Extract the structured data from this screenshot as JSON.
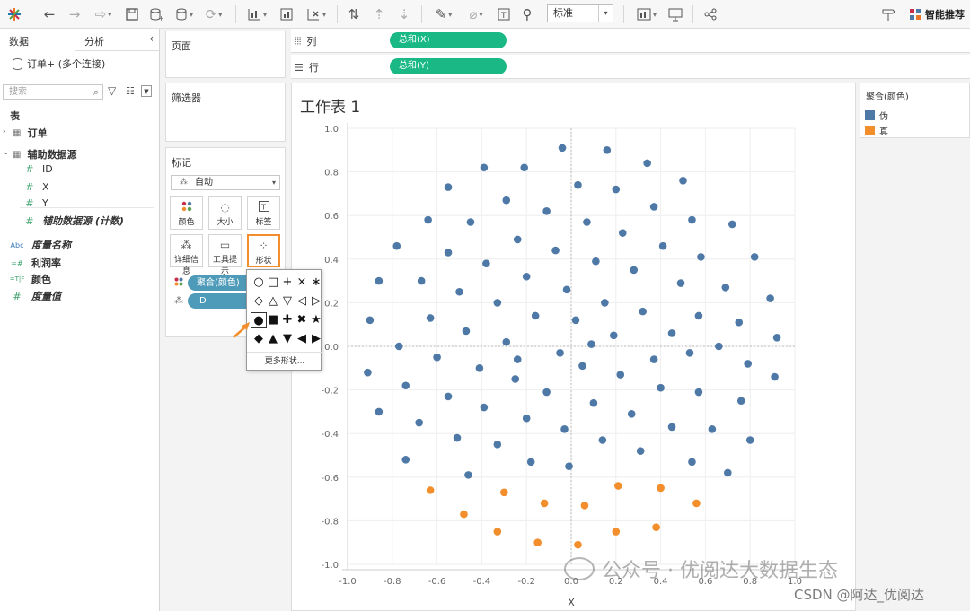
{
  "toolbar": {
    "standard_label": "标准",
    "smart_recommend": "智能推荐"
  },
  "left_pane": {
    "tab_data": "数据",
    "tab_analysis": "分析",
    "datasource": "订单+ (多个连接)",
    "search_placeholder": "搜索",
    "tables_header": "表",
    "table_orders": "订单",
    "table_aux": "辅助数据源",
    "fields": [
      "ID",
      "X",
      "Y",
      "辅助数据源 (计数)"
    ],
    "measure_names": "度量名称",
    "profit_rate": "利润率",
    "color": "颜色",
    "measure_values": "度量值",
    "icon_abc": "Abc",
    "icon_hash": "#",
    "icon_calc": "=#",
    "icon_bool": "=T|F"
  },
  "cards": {
    "pages": "页面",
    "filters": "筛选器",
    "marks": "标记",
    "mark_type": "自动",
    "buttons": {
      "color": "颜色",
      "size": "大小",
      "label": "标签",
      "detail": "详细信息",
      "tooltip": "工具提示",
      "shape": "形状"
    },
    "pill_color": "聚合(颜色)",
    "pill_id": "ID"
  },
  "shelves": {
    "columns_label": "列",
    "rows_label": "行",
    "columns_pill": "总和(X)",
    "rows_pill": "总和(Y)"
  },
  "worksheet": {
    "title": "工作表 1"
  },
  "legend": {
    "title": "聚合(颜色)",
    "items": [
      {
        "label": "伪",
        "color": "#4e79a7"
      },
      {
        "label": "真",
        "color": "#f28e2b"
      }
    ]
  },
  "shape_popup": {
    "shapes": [
      "○",
      "□",
      "+",
      "×",
      "∗",
      "◇",
      "△",
      "▽",
      "◁",
      "▷",
      "●",
      "■",
      "✚",
      "✖",
      "★",
      "◆",
      "▲",
      "▼",
      "◀",
      "▶"
    ],
    "selected_index": 10,
    "more": "更多形状..."
  },
  "watermark": {
    "line1": "公众号 · 优阅达大数据生态",
    "line2": "CSDN @阿达_优阅达"
  },
  "chart_data": {
    "type": "scatter",
    "title": "工作表 1",
    "xlabel": "X",
    "ylabel": "",
    "xlim": [
      -1.0,
      1.0
    ],
    "ylim": [
      -1.0,
      1.0
    ],
    "x_ticks": [
      "-1.0",
      "-0.8",
      "-0.6",
      "-0.4",
      "-0.2",
      "0.0",
      "0.2",
      "0.4",
      "0.6",
      "0.8",
      "1.0"
    ],
    "y_ticks": [
      "1.0",
      "0.8",
      "0.6",
      "0.4",
      "0.2",
      "0.0",
      "-0.2",
      "-0.4",
      "-0.6",
      "-0.8",
      "-1.0"
    ],
    "grid": true,
    "series": [
      {
        "name": "伪",
        "color": "#4e79a7",
        "points": [
          [
            -0.04,
            0.91
          ],
          [
            0.16,
            0.9
          ],
          [
            0.34,
            0.84
          ],
          [
            -0.39,
            0.82
          ],
          [
            -0.21,
            0.82
          ],
          [
            0.5,
            0.76
          ],
          [
            0.03,
            0.74
          ],
          [
            -0.55,
            0.73
          ],
          [
            0.2,
            0.72
          ],
          [
            -0.29,
            0.67
          ],
          [
            -0.11,
            0.62
          ],
          [
            0.37,
            0.64
          ],
          [
            0.07,
            0.57
          ],
          [
            -0.45,
            0.57
          ],
          [
            -0.64,
            0.58
          ],
          [
            0.54,
            0.58
          ],
          [
            0.72,
            0.56
          ],
          [
            0.23,
            0.52
          ],
          [
            -0.24,
            0.49
          ],
          [
            -0.78,
            0.46
          ],
          [
            -0.07,
            0.44
          ],
          [
            0.41,
            0.46
          ],
          [
            -0.55,
            0.43
          ],
          [
            0.58,
            0.41
          ],
          [
            0.82,
            0.41
          ],
          [
            -0.38,
            0.38
          ],
          [
            0.11,
            0.39
          ],
          [
            -0.2,
            0.32
          ],
          [
            0.28,
            0.35
          ],
          [
            -0.67,
            0.3
          ],
          [
            -0.86,
            0.3
          ],
          [
            0.69,
            0.27
          ],
          [
            -0.5,
            0.25
          ],
          [
            -0.02,
            0.26
          ],
          [
            0.49,
            0.29
          ],
          [
            -0.33,
            0.2
          ],
          [
            0.15,
            0.2
          ],
          [
            0.89,
            0.22
          ],
          [
            -0.16,
            0.14
          ],
          [
            0.32,
            0.16
          ],
          [
            0.57,
            0.14
          ],
          [
            -0.63,
            0.13
          ],
          [
            -0.9,
            0.12
          ],
          [
            0.02,
            0.12
          ],
          [
            0.75,
            0.11
          ],
          [
            -0.47,
            0.07
          ],
          [
            0.19,
            0.05
          ],
          [
            -0.29,
            0.02
          ],
          [
            0.45,
            0.06
          ],
          [
            0.92,
            0.04
          ],
          [
            -0.77,
            0.0
          ],
          [
            0.66,
            0.0
          ],
          [
            0.09,
            0.01
          ],
          [
            -0.05,
            -0.03
          ],
          [
            0.53,
            -0.03
          ],
          [
            -0.6,
            -0.05
          ],
          [
            -0.24,
            -0.06
          ],
          [
            0.37,
            -0.06
          ],
          [
            -0.41,
            -0.1
          ],
          [
            0.05,
            -0.09
          ],
          [
            0.79,
            -0.08
          ],
          [
            -0.91,
            -0.12
          ],
          [
            0.22,
            -0.13
          ],
          [
            -0.11,
            -0.21
          ],
          [
            0.91,
            -0.14
          ],
          [
            -0.74,
            -0.18
          ],
          [
            -0.25,
            -0.15
          ],
          [
            0.4,
            -0.19
          ],
          [
            -0.55,
            -0.23
          ],
          [
            0.57,
            -0.21
          ],
          [
            0.1,
            -0.26
          ],
          [
            -0.39,
            -0.28
          ],
          [
            0.76,
            -0.25
          ],
          [
            -0.86,
            -0.3
          ],
          [
            -0.2,
            -0.33
          ],
          [
            0.27,
            -0.31
          ],
          [
            -0.68,
            -0.35
          ],
          [
            0.45,
            -0.37
          ],
          [
            -0.03,
            -0.38
          ],
          [
            0.63,
            -0.38
          ],
          [
            -0.51,
            -0.42
          ],
          [
            0.14,
            -0.43
          ],
          [
            0.8,
            -0.43
          ],
          [
            -0.33,
            -0.45
          ],
          [
            0.31,
            -0.48
          ],
          [
            -0.74,
            -0.52
          ],
          [
            -0.18,
            -0.53
          ],
          [
            0.54,
            -0.53
          ],
          [
            -0.01,
            -0.55
          ],
          [
            0.7,
            -0.58
          ],
          [
            -0.46,
            -0.59
          ]
        ]
      },
      {
        "name": "真",
        "color": "#f28e2b",
        "points": [
          [
            -0.63,
            -0.66
          ],
          [
            -0.3,
            -0.67
          ],
          [
            0.21,
            -0.64
          ],
          [
            0.4,
            -0.65
          ],
          [
            -0.12,
            -0.72
          ],
          [
            0.06,
            -0.73
          ],
          [
            0.56,
            -0.72
          ],
          [
            -0.48,
            -0.77
          ],
          [
            -0.33,
            -0.85
          ],
          [
            0.38,
            -0.83
          ],
          [
            0.2,
            -0.85
          ],
          [
            -0.15,
            -0.9
          ],
          [
            0.03,
            -0.91
          ]
        ]
      }
    ]
  }
}
